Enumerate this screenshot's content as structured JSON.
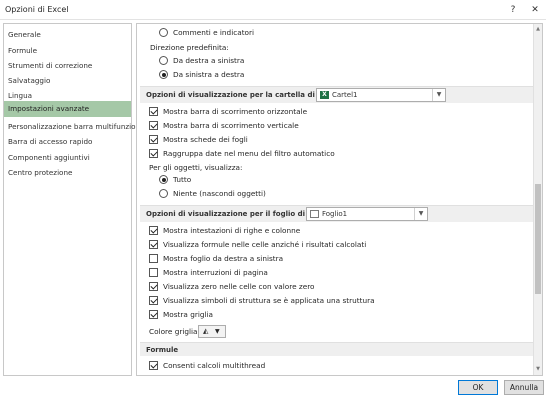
{
  "window": {
    "title": "Opzioni di Excel",
    "help_icon": "?",
    "close_icon": "✕"
  },
  "sidebar": {
    "items": [
      {
        "label": "Generale"
      },
      {
        "label": "Formule"
      },
      {
        "label": "Strumenti di correzione"
      },
      {
        "label": "Salvataggio"
      },
      {
        "label": "Lingua"
      },
      {
        "label": "Impostazioni avanzate",
        "selected": true
      },
      {
        "label": "Personalizzazione barra multifunzione"
      },
      {
        "label": "Barra di accesso rapido"
      },
      {
        "label": "Componenti aggiuntivi"
      },
      {
        "label": "Centro protezione"
      }
    ]
  },
  "top_partial": {
    "commenti_label": "Commenti e indicatori",
    "direzione_label": "Direzione predefinita:",
    "rtl_label": "Da destra a sinistra",
    "ltr_label": "Da sinistra a destra"
  },
  "workbook_section": {
    "header": "Opzioni di visualizzazione per la cartella di lavoro:",
    "combo_value": "Cartel1",
    "options": [
      {
        "label": "Mostra barra di scorrimento orizzontale",
        "checked": true
      },
      {
        "label": "Mostra barra di scorrimento verticale",
        "checked": true
      },
      {
        "label": "Mostra schede dei fogli",
        "checked": true
      },
      {
        "label": "Raggruppa date nel menu del filtro automatico",
        "checked": true
      }
    ],
    "objects_label": "Per gli oggetti, visualizza:",
    "objects_all": "Tutto",
    "objects_none": "Niente (nascondi oggetti)"
  },
  "sheet_section": {
    "header": "Opzioni di visualizzazione per il foglio di lavoro:",
    "combo_value": "Foglio1",
    "options": [
      {
        "label": "Mostra intestazioni di righe e colonne",
        "checked": true
      },
      {
        "label": "Visualizza formule nelle celle anziché i risultati calcolati",
        "checked": true
      },
      {
        "label": "Mostra foglio da destra a sinistra",
        "checked": false
      },
      {
        "label": "Mostra interruzioni di pagina",
        "checked": false
      },
      {
        "label": "Visualizza zero nelle celle con valore zero",
        "checked": true
      },
      {
        "label": "Visualizza simboli di struttura se è applicata una struttura",
        "checked": true
      },
      {
        "label": "Mostra griglia",
        "checked": true
      }
    ],
    "grid_color_label": "Colore griglia"
  },
  "formule_section": {
    "header": "Formule",
    "multithread_label": "Consenti calcoli multithread"
  },
  "buttons": {
    "ok": "OK",
    "cancel": "Annulla"
  },
  "colors": {
    "selected_item": "#a5c8a7",
    "section_bg": "#efefef",
    "excel_green": "#1e7145"
  }
}
